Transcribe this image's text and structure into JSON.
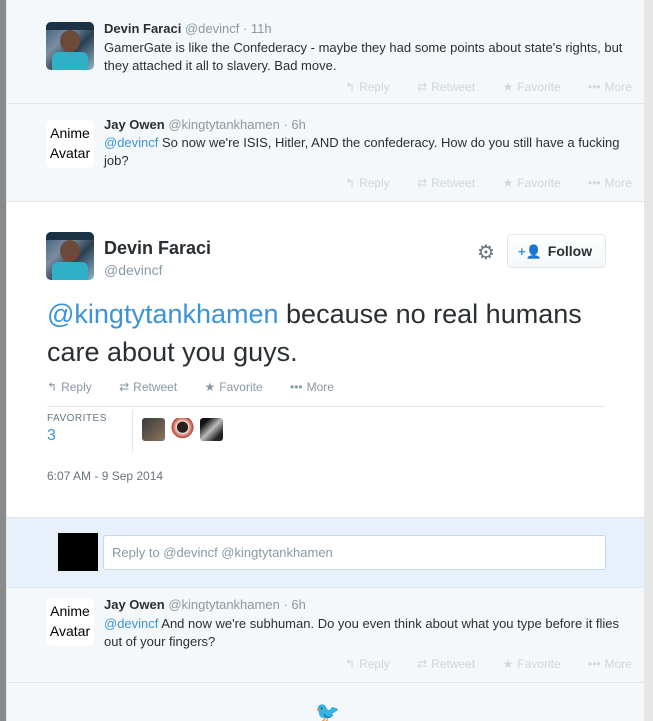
{
  "tweet1": {
    "name": "Devin Faraci",
    "handle": "@devincf",
    "time": "· 11h",
    "text": "GamerGate is like the Confederacy - maybe they had some points about state's rights, but they attached it all to slavery. Bad move.",
    "actions": {
      "reply": "Reply",
      "retweet": "Retweet",
      "favorite": "Favorite",
      "more": "More"
    }
  },
  "tweet2": {
    "avatar_text": "Anime Avatar",
    "name": "Jay Owen",
    "handle": "@kingtytankhamen",
    "time": "· 6h",
    "mention": "@devincf",
    "text": " So now we're ISIS, Hitler, AND the confederacy. How do you still have a fucking job?",
    "actions": {
      "reply": "Reply",
      "retweet": "Retweet",
      "favorite": "Favorite",
      "more": "More"
    }
  },
  "main_tweet": {
    "name": "Devin Faraci",
    "handle": "@devincf",
    "follow_label": "Follow",
    "mention": "@kingtytankhamen",
    "text": " because no real humans care about you guys.",
    "actions": {
      "reply": "Reply",
      "retweet": "Retweet",
      "favorite": "Favorite",
      "more": "More"
    },
    "stat_label": "FAVORITES",
    "stat_value": "3",
    "timestamp": "6:07 AM - 9 Sep 2014"
  },
  "reply_box": {
    "placeholder": "Reply to @devincf @kingtytankhamen"
  },
  "tweet3": {
    "avatar_text": "Anime Avatar",
    "name": "Jay Owen",
    "handle": "@kingtytankhamen",
    "time": "· 6h",
    "mention": "@devincf",
    "text": " And now we're subhuman. Do you even think about what you type before it flies out of your fingers?",
    "actions": {
      "reply": "Reply",
      "retweet": "Retweet",
      "favorite": "Favorite",
      "more": "More"
    }
  },
  "colors": {
    "link": "#3b94d9",
    "muted": "#8899a6",
    "action_faded": "#ccd6dd"
  },
  "icons": [
    "reply-icon",
    "retweet-icon",
    "favorite-icon",
    "more-icon",
    "gear-icon",
    "follow-user-icon",
    "twitter-bird-icon"
  ]
}
